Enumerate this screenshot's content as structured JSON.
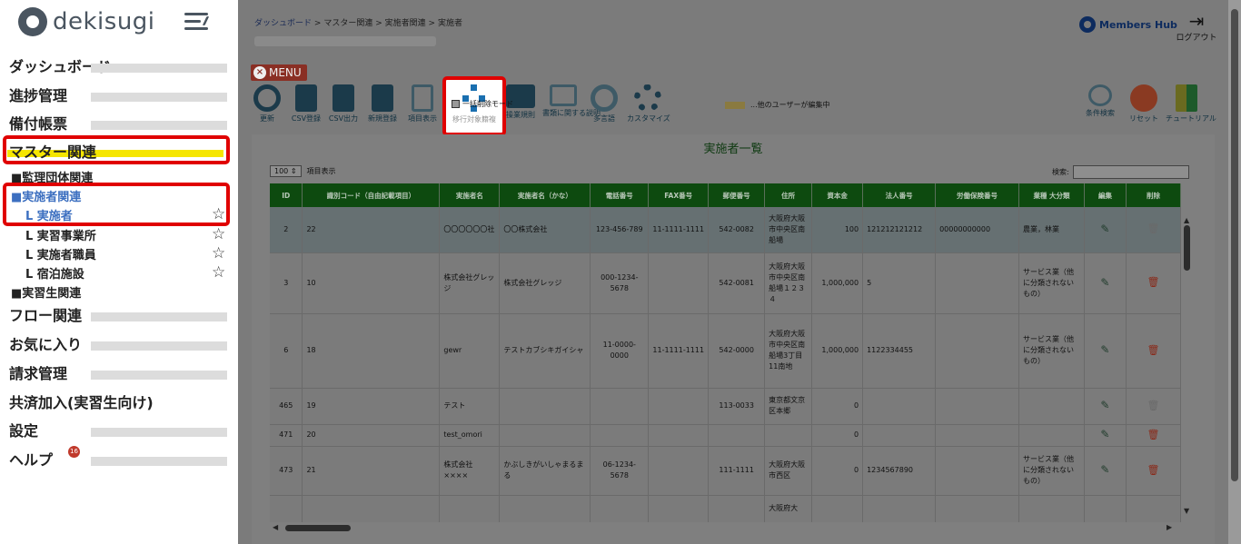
{
  "app": {
    "logo_text": "dekisugi"
  },
  "sidebar": {
    "items": [
      {
        "label": "ダッシュボード"
      },
      {
        "label": "進捗管理"
      },
      {
        "label": "備付帳票"
      },
      {
        "label": "マスター関連"
      },
      {
        "label": "フロー関連"
      },
      {
        "label": "お気に入り"
      },
      {
        "label": "請求管理"
      },
      {
        "label": "共済加入(実習生向け)"
      },
      {
        "label": "設定"
      },
      {
        "label": "ヘルプ"
      }
    ],
    "sub": [
      {
        "label": "■監理団体関連"
      },
      {
        "label": "■実施者関連"
      },
      {
        "label": "L 実施者"
      },
      {
        "label": "L 実習事業所"
      },
      {
        "label": "L 実施者職員"
      },
      {
        "label": "L 宿泊施設"
      },
      {
        "label": "■実習生関連"
      }
    ],
    "help_badge": "16",
    "colors": {
      "highlight": "#e00000",
      "active_bar": "#f5e600"
    }
  },
  "header": {
    "breadcrumb": [
      "ダッシュボード",
      ">",
      "マスター関連",
      ">",
      "実施者関連",
      ">",
      "実施者"
    ],
    "members_hub": "Members Hub",
    "logout": "ログアウト"
  },
  "toolbar": {
    "menu_label": "MENU",
    "tools": [
      {
        "label": "更新"
      },
      {
        "label": "CSV登録"
      },
      {
        "label": "CSV出力"
      },
      {
        "label": "新規登録"
      },
      {
        "label": "項目表示"
      },
      {
        "label": "移行対象籍複"
      },
      {
        "label": "操業規則"
      },
      {
        "label": "書類に関する説明"
      },
      {
        "label": "多言語"
      },
      {
        "label": "カスタマイズ"
      },
      {
        "label": "条件検索"
      },
      {
        "label": "リセット"
      },
      {
        "label": "チュートリアル"
      }
    ],
    "bulk_delete": "一括削除モード",
    "editing_note": "...他のユーザーが編集中",
    "icons": [
      "refresh-icon",
      "csv-import-icon",
      "csv-export-icon",
      "new-record-icon",
      "column-display-icon",
      "flow-icon",
      "book-icon",
      "document-icon",
      "globe-icon",
      "gear-icon",
      "search-icon",
      "minus-circle-icon",
      "beginner-icon"
    ]
  },
  "table": {
    "title": "実施者一覧",
    "page_size": "100",
    "page_size_label": "項目表示",
    "search_label": "検索:",
    "columns": [
      "ID",
      "識別コード（自由記載項目）",
      "実施者名",
      "実施者名（かな）",
      "電話番号",
      "FAX番号",
      "郵便番号",
      "住所",
      "資本金",
      "法人番号",
      "労働保険番号",
      "業種 大分類",
      "編集",
      "削除"
    ],
    "rows": [
      [
        "2",
        "22",
        "〇〇〇〇〇〇社",
        "〇〇株式会社",
        "123-456-789",
        "11-1111-1111",
        "542-0082",
        "大阪府大阪市中央区南船場",
        "100",
        "121212121212",
        "00000000000",
        "農業，林業"
      ],
      [
        "3",
        "10",
        "株式会社グレッジ",
        "株式会社グレッジ",
        "000-1234-5678",
        "",
        "542-0081",
        "大阪府大阪市中央区南船場１２３４",
        "1,000,000",
        "5",
        "",
        "サービス業（他に分類されないもの）"
      ],
      [
        "6",
        "18",
        "gewr",
        "テストカブシキガイシャ",
        "11-0000-0000",
        "11-1111-1111",
        "542-0000",
        "大阪府大阪市中央区南船場3丁目11南地",
        "1,000,000",
        "1122334455",
        "",
        "サービス業（他に分類されないもの）"
      ],
      [
        "465",
        "19",
        "テスト",
        "",
        "",
        "",
        "113-0033",
        "東京都文京区本郷",
        "0",
        "",
        "",
        ""
      ],
      [
        "471",
        "20",
        "test_omori",
        "",
        "",
        "",
        "",
        "",
        "0",
        "",
        "",
        ""
      ],
      [
        "473",
        "21",
        "株式会社××××",
        "かぶしきがいしゃまるまる",
        "06-1234-5678",
        "",
        "111-1111",
        "大阪府大阪市西区",
        "0",
        "1234567890",
        "",
        "サービス業（他に分類されないもの）"
      ],
      [
        "",
        "",
        "",
        "",
        "",
        "",
        "",
        "大阪府大",
        "",
        "",
        "",
        ""
      ]
    ],
    "colors": {
      "header_bg": "#0d4a0f",
      "selected_row": "#667072"
    }
  }
}
